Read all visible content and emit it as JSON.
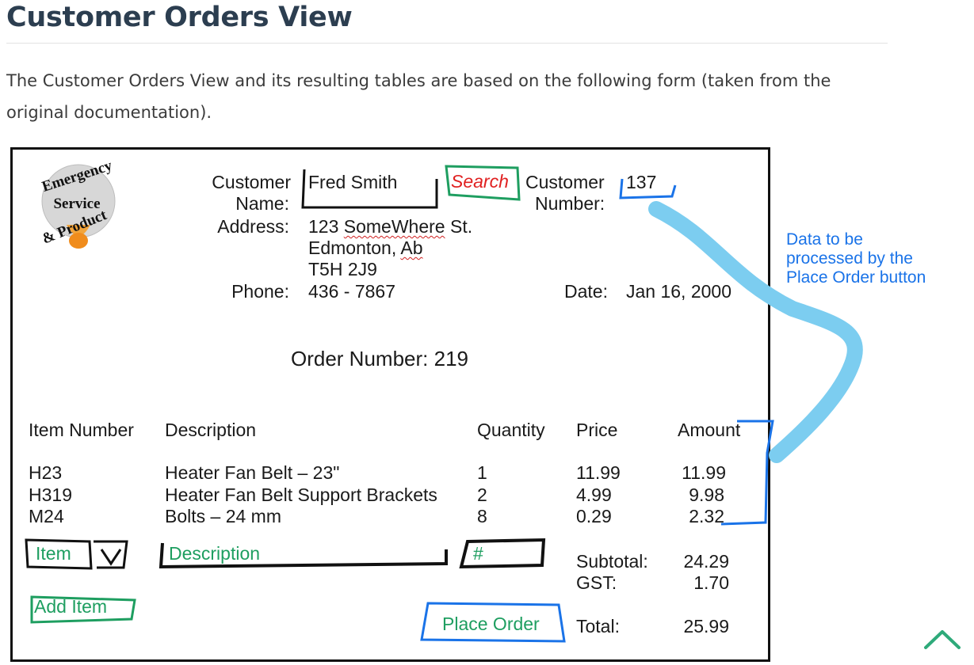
{
  "header": {
    "title": "Customer Orders View",
    "intro": "The Customer Orders View and its resulting tables are based on the following form (taken from the original documentation)."
  },
  "form": {
    "logo_lines": [
      "Emergency",
      "Service",
      "& Product"
    ],
    "customer_name_label_1": "Customer",
    "customer_name_label_2": "Name:",
    "customer_name_value": "Fred Smith",
    "search_button": "Search",
    "customer_number_label_1": "Customer",
    "customer_number_label_2": "Number:",
    "customer_number_value": "137",
    "address_label": "Address:",
    "address_line1_a": "123 ",
    "address_line1_b": "SomeWhere",
    "address_line1_c": " St.",
    "address_line2_a": "Edmonton, ",
    "address_line2_b": "Ab",
    "address_line3": "T5H 2J9",
    "phone_label": "Phone:",
    "phone_value": "436 - 7867",
    "date_label": "Date:",
    "date_value": "Jan 16, 2000",
    "order_number": "Order Number: 219",
    "columns": [
      "Item Number",
      "Description",
      "Quantity",
      "Price",
      "Amount"
    ],
    "rows": [
      {
        "item": "H23",
        "description": "Heater Fan Belt – 23\"",
        "quantity": "1",
        "price": "11.99",
        "amount": "11.99"
      },
      {
        "item": "H319",
        "description": "Heater Fan Belt Support Brackets",
        "quantity": "2",
        "price": "4.99",
        "amount": "9.98"
      },
      {
        "item": "M24",
        "description": "Bolts – 24 mm",
        "quantity": "8",
        "price": "0.29",
        "amount": "2.32"
      }
    ],
    "item_input": "Item",
    "description_input": "Description",
    "quantity_input": "#",
    "subtotal_label": "Subtotal:",
    "subtotal_value": "24.29",
    "gst_label": "GST:",
    "gst_value": "1.70",
    "add_item_button": "Add Item",
    "place_order_button": "Place Order",
    "total_label": "Total:",
    "total_value": "25.99"
  },
  "annotation": {
    "line1": "Data to be",
    "line2": "processed by the",
    "line3": "Place Order button"
  },
  "colors": {
    "heading": "#2c3e50",
    "annotation_blue": "#1a73e8",
    "highlight_blue": "#7ccdf0",
    "control_green": "#1e9e60",
    "search_red": "#e02020",
    "back_to_top": "#2eaa7a"
  },
  "icons": {
    "back_to_top": "chevron-up-icon",
    "dropdown": "dropdown-arrow-icon"
  }
}
